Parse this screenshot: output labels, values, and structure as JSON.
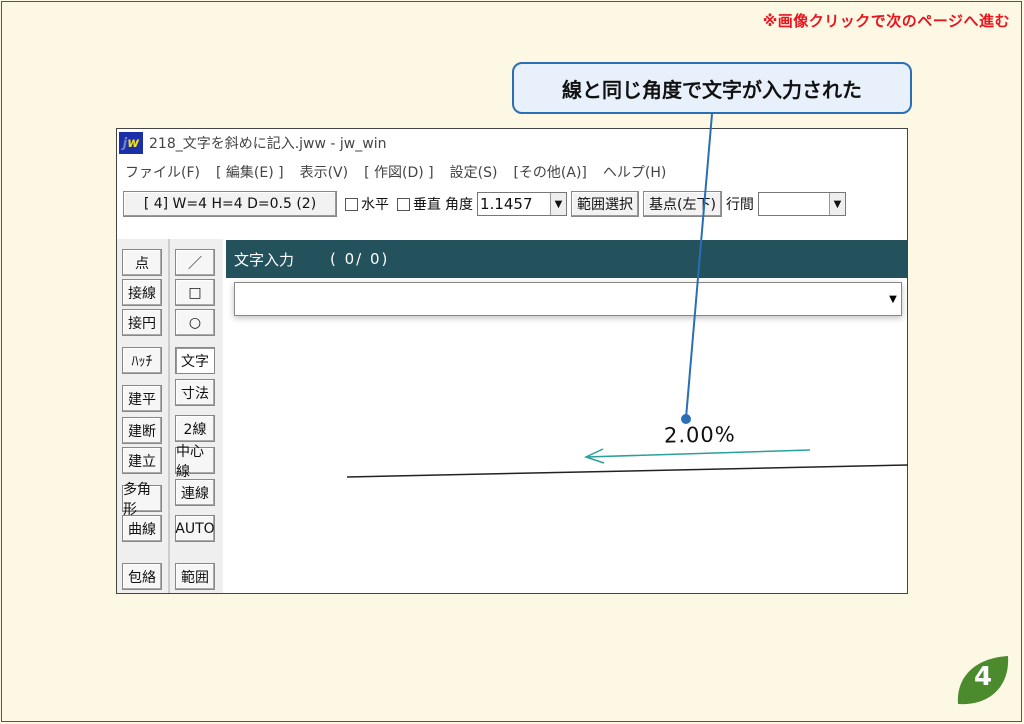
{
  "notice": "※画像クリックで次のページへ進む",
  "callout": "線と同じ角度で文字が入力された",
  "window": {
    "title": "218_文字を斜めに記入.jww - jw_win",
    "menus": [
      "ファイル(F)",
      "[ 編集(E) ]",
      "表示(V)",
      "[ 作図(D) ]",
      "設定(S)",
      "[その他(A)]",
      "ヘルプ(H)"
    ],
    "toolbar": {
      "size_button": "[ 4]  W=4  H=4  D=0.5 (2)",
      "horizontal_label": "水平",
      "vertical_label": "垂直",
      "angle_label": "角度",
      "angle_value": "1.1457",
      "range_button": "範囲選択",
      "base_button": "基点(左下)",
      "line_spacing_label": "行間"
    },
    "tools_left": [
      "点",
      "接線",
      "接円",
      "ﾊｯﾁ",
      "建平",
      "建断",
      "建立",
      "多角形",
      "曲線",
      "包絡"
    ],
    "tools_right": [
      "／",
      "□",
      "○",
      "文字",
      "寸法",
      "2線",
      "中心線",
      "連線",
      "AUTO",
      "範囲"
    ],
    "text_input": {
      "title": "文字入力",
      "count": "( 0/  0)",
      "value": ""
    },
    "drawn_text": "2.00%"
  },
  "page_number": "4",
  "colors": {
    "background": "#fdf8e4",
    "notice": "#e8141e",
    "callout_border": "#2a6fb5",
    "input_header": "#24525c",
    "arrow": "#2aa198",
    "leaf": "#4c8a2e"
  }
}
